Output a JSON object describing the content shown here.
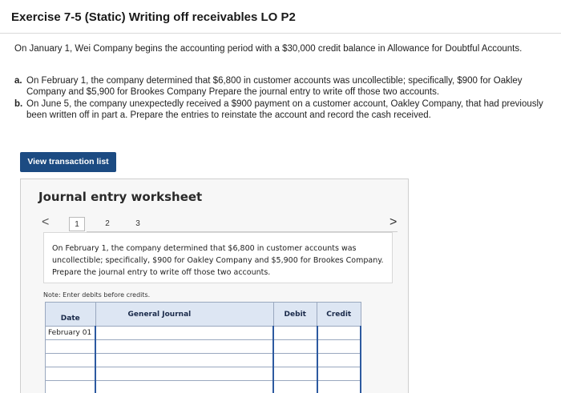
{
  "header": {
    "title": "Exercise 7-5 (Static) Writing off receivables LO P2"
  },
  "intro": "On January 1, Wei Company begins the accounting period with a $30,000 credit balance in Allowance for Doubtful Accounts.",
  "questions": [
    {
      "letter": "a.",
      "text": "On February 1, the company determined that $6,800 in customer accounts was uncollectible; specifically, $900 for Oakley Company and $5,900 for Brookes Company Prepare the journal entry to write off those two accounts."
    },
    {
      "letter": "b.",
      "text": "On June 5, the company unexpectedly received a $900 payment on a customer account, Oakley Company, that had previously been written off in part a. Prepare the entries to reinstate the account and record the cash received."
    }
  ],
  "view_button_label": "View transaction list",
  "worksheet": {
    "title": "Journal entry worksheet",
    "pager": {
      "prev": "<",
      "next": ">",
      "pages": [
        "1",
        "2",
        "3"
      ],
      "active": "1"
    },
    "prompt": "On February 1, the company determined that $6,800 in customer accounts was uncollectible; specifically, $900 for Oakley Company and $5,900 for Brookes Company. Prepare the journal entry to write off those two accounts.",
    "note": "Note: Enter debits before credits.",
    "table": {
      "headers": {
        "date": "Date",
        "journal": "General Journal",
        "debit": "Debit",
        "credit": "Credit"
      },
      "rows": [
        {
          "date": "February 01",
          "account": "",
          "debit": "",
          "credit": ""
        },
        {
          "date": "",
          "account": "",
          "debit": "",
          "credit": ""
        },
        {
          "date": "",
          "account": "",
          "debit": "",
          "credit": ""
        },
        {
          "date": "",
          "account": "",
          "debit": "",
          "credit": ""
        },
        {
          "date": "",
          "account": "",
          "debit": "",
          "credit": ""
        }
      ]
    }
  }
}
